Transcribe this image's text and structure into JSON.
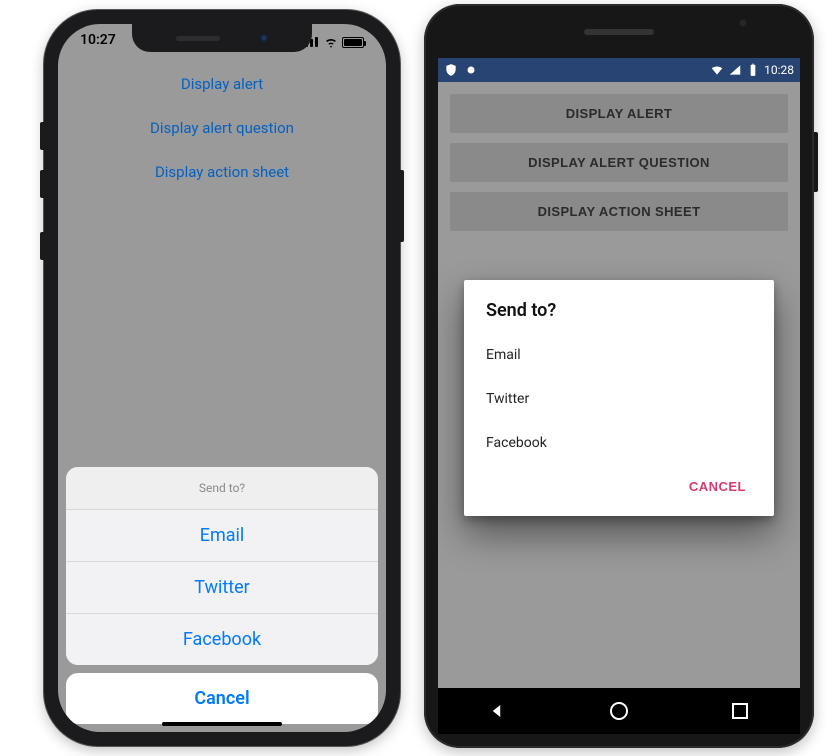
{
  "ios": {
    "status_time": "10:27",
    "links": {
      "alert": "Display alert",
      "question": "Display alert question",
      "action_sheet": "Display action sheet"
    },
    "sheet": {
      "title": "Send to?",
      "items": [
        "Email",
        "Twitter",
        "Facebook"
      ],
      "cancel": "Cancel"
    }
  },
  "android": {
    "status_time": "10:28",
    "buttons": {
      "alert": "DISPLAY ALERT",
      "question": "DISPLAY ALERT QUESTION",
      "action_sheet": "DISPLAY ACTION SHEET"
    },
    "dialog": {
      "title": "Send to?",
      "items": [
        "Email",
        "Twitter",
        "Facebook"
      ],
      "cancel": "CANCEL"
    }
  },
  "colors": {
    "ios_link": "#007aff",
    "android_accent": "#d83973",
    "android_statusbar": "#284472"
  }
}
